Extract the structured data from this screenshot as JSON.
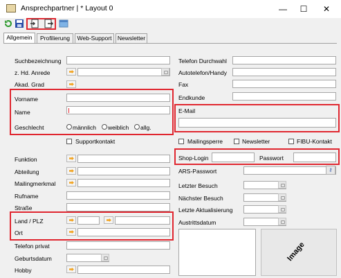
{
  "window": {
    "title": "Ansprechpartner | * Layout 0",
    "minimize_glyph": "—",
    "maximize_glyph": "☐",
    "close_glyph": "✕"
  },
  "tabs": [
    {
      "label": "Allgemein"
    },
    {
      "label": "Profilierung"
    },
    {
      "label": "Web-Support"
    },
    {
      "label": "Newsletter"
    }
  ],
  "left": {
    "suchbezeichnung": "Suchbezeichnung",
    "anrede": "z. Hd. Anrede",
    "grad": "Akad. Grad",
    "vorname": "Vorname",
    "name": "Name",
    "geschlecht": "Geschlecht",
    "radios": [
      "männlich",
      "weiblich",
      "allg."
    ],
    "supportkontakt": "Supportkontakt",
    "funktion": "Funktion",
    "abteilung": "Abteilung",
    "mailingmerkmal": "Mailingmerkmal",
    "rufname": "Rufname",
    "strasse": "Straße",
    "land_plz": "Land / PLZ",
    "ort": "Ort",
    "telefon_privat": "Telefon privat",
    "geburtsdatum": "Geburtsdatum",
    "hobby": "Hobby"
  },
  "right": {
    "telefon_durchwahl": "Telefon Durchwahl",
    "autotelefon": "Autotelefon/Handy",
    "fax": "Fax",
    "endkunde": "Endkunde",
    "email": "E-Mail",
    "mailingsperre": "Mailingsperre",
    "newsletter": "Newsletter",
    "fibu": "FIBU-Kontakt",
    "shop_login": "Shop-Login",
    "passwort": "Passwort",
    "ars_passwort": "ARS-Passwort",
    "letzter_besuch": "Letzter Besuch",
    "naechster_besuch": "Nächster Besuch",
    "letzte_aktualisierung": "Letzte Aktualisierung",
    "austrittsdatum": "Austrittsdatum",
    "image_label": "Image"
  },
  "colors": {
    "highlight": "#e0262f",
    "arrow": "#f2a31f"
  }
}
